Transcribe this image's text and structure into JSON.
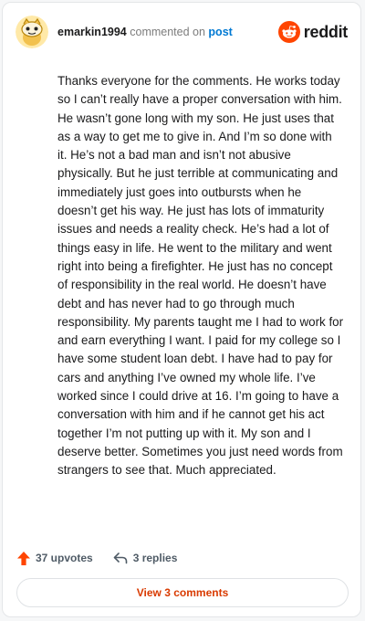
{
  "header": {
    "username": "emarkin1994",
    "action_text": "commented on",
    "target_link": "post",
    "brand": "reddit"
  },
  "comment": {
    "body": "Thanks everyone for the comments. He works today so I can’t really have a proper conversation with him. He wasn’t gone long with my son. He just uses that as a way to get me to give in. And I’m so done with it. He’s not a bad man and isn’t not abusive physically. But he just terrible at communicating and immediately just goes into outbursts when he doesn’t get his way. He just has lots of immaturity issues and needs a reality check. He’s had a lot of things easy in life. He went to the military and went right into being a firefighter. He just has no concept of responsibility in the real world. He doesn’t have debt and has never had to go through much responsibility. My parents taught me I had to work for and earn everything I want. I paid for my college so I have some student loan debt. I have had to pay for cars and anything I’ve owned my whole life. I’ve worked since I could drive at 16. I’m going to have a conversation with him and if he cannot get his act together I’m not putting up with it. My son and I deserve better. Sometimes you just need words from strangers to see that. Much appreciated."
  },
  "actions": {
    "upvotes": "37 upvotes",
    "replies": "3 replies"
  },
  "footer": {
    "view_button": "View 3 comments"
  },
  "colors": {
    "accent": "#d93a00",
    "link": "#0079d3",
    "upvote": "#ff4500"
  },
  "icons": {
    "avatar": "snoo-avatar-icon",
    "brand": "reddit-logo-icon",
    "upvote": "upvote-arrow-icon",
    "reply": "reply-arrow-icon"
  }
}
